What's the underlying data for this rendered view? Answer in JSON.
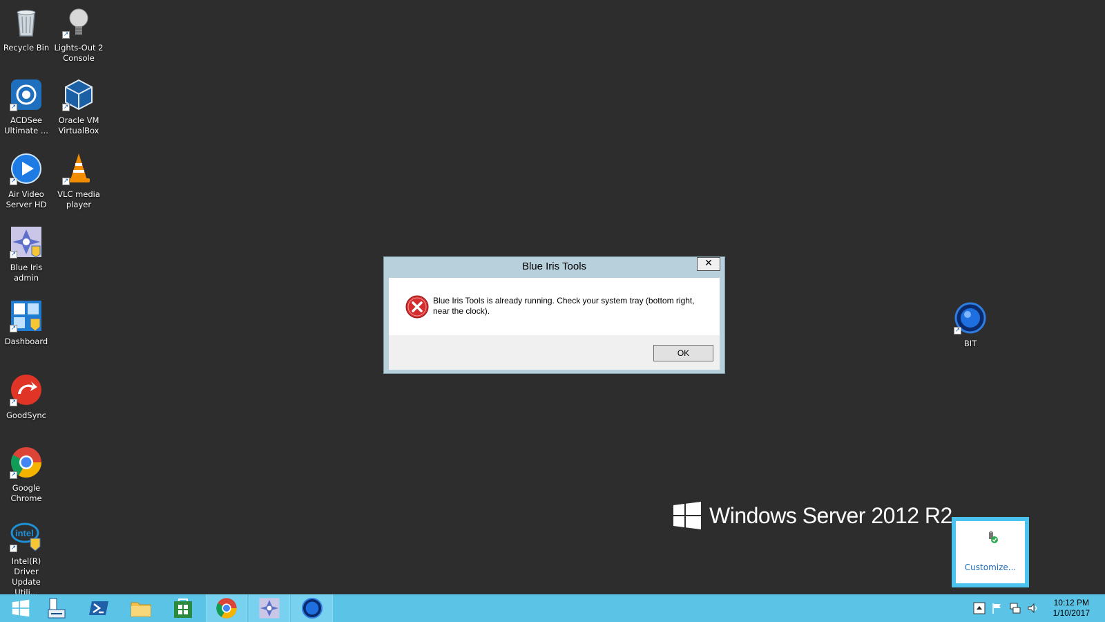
{
  "desktop": {
    "icons": [
      {
        "label": "Recycle Bin",
        "icon": "recycle-bin-icon"
      },
      {
        "label": "Lights-Out 2\nConsole",
        "icon": "lightbulb-icon"
      },
      {
        "label": "ACDSee\nUltimate ...",
        "icon": "camera-aperture-icon"
      },
      {
        "label": "Oracle VM\nVirtualBox",
        "icon": "virtualbox-cube-icon"
      },
      {
        "label": "Air Video\nServer HD",
        "icon": "play-circle-icon"
      },
      {
        "label": "VLC media\nplayer",
        "icon": "vlc-cone-icon"
      },
      {
        "label": "Blue Iris\nadmin",
        "icon": "blue-iris-admin-icon"
      },
      {
        "label": "Dashboard",
        "icon": "dashboard-icon"
      },
      {
        "label": "GoodSync",
        "icon": "goodsync-icon"
      },
      {
        "label": "Google\nChrome",
        "icon": "chrome-icon"
      },
      {
        "label": "Intel(R) Driver\nUpdate Utili...",
        "icon": "intel-icon"
      },
      {
        "label": "BIT",
        "icon": "blue-orb-icon"
      }
    ]
  },
  "dialog": {
    "title": "Blue Iris Tools",
    "close_label": "✕",
    "message": "Blue Iris Tools is already running. Check your system tray (bottom right, near the clock).",
    "ok_label": "OK",
    "icon": "error-x-icon"
  },
  "watermark": {
    "text": "Windows Server 2012 R2"
  },
  "tray_popup": {
    "customize_label": "Customize..."
  },
  "taskbar": {
    "buttons": [
      {
        "name": "start",
        "icon": "windows-logo-icon"
      },
      {
        "name": "server-manager",
        "icon": "server-manager-icon"
      },
      {
        "name": "powershell",
        "icon": "powershell-icon"
      },
      {
        "name": "file-explorer",
        "icon": "folder-icon"
      },
      {
        "name": "store",
        "icon": "store-icon"
      },
      {
        "name": "chrome",
        "icon": "chrome-icon"
      },
      {
        "name": "blue-iris-admin",
        "icon": "blue-iris-admin-icon"
      },
      {
        "name": "bit",
        "icon": "blue-orb-icon"
      }
    ],
    "clock": {
      "time": "10:12 PM",
      "date": "1/10/2017"
    }
  },
  "colors": {
    "desktop_bg": "#2d2d2d",
    "taskbar_bg": "#5bc3e6",
    "dialog_frame": "#b8d0dc",
    "error_red": "#d42e2e"
  }
}
